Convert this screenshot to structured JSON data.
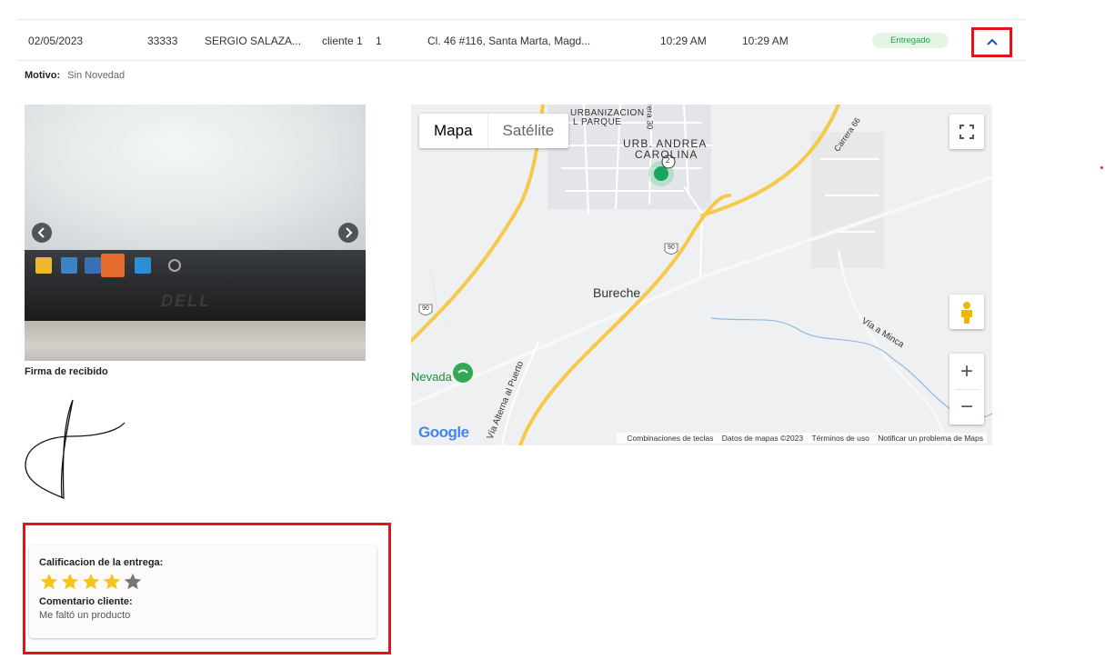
{
  "row": {
    "date": "02/05/2023",
    "code": "33333",
    "name": "SERGIO SALAZA...",
    "client": "cliente 1",
    "quantity": "1",
    "address": "Cl. 46 #116, Santa Marta, Magd...",
    "time_1": "10:29 AM",
    "time_2": "10:29 AM",
    "status": "Entregado",
    "status_color": "#2e9a48"
  },
  "motivo": {
    "label": "Motivo:",
    "value": "Sin Novedad"
  },
  "signature": {
    "label": "Firma de recibido"
  },
  "photo_text": {
    "logo": "DELL"
  },
  "map": {
    "view_map": "Mapa",
    "view_satellite": "Satélite",
    "labels": {
      "urbanizacion": "URBANIZACION",
      "el_parque": "L PARQUE",
      "andrea": "URB. ANDREA",
      "carolina": "CAROLINA",
      "bureche": "Bureche",
      "nevada": "Nevada",
      "via_minca": "Vía a Minca",
      "carrera66": "Carrera 66",
      "carrera30": "rera 30",
      "alterna": "Vía Alterna al Puerto",
      "road90a": "90",
      "road90b": "90",
      "marker_num": "2"
    },
    "google": "Google",
    "footer": {
      "shortcuts": "Combinaciones de teclas",
      "data": "Datos de mapas ©2023",
      "terms": "Términos de uso",
      "report": "Notificar un problema de Maps"
    },
    "zoom_in": "+",
    "zoom_out": "−"
  },
  "rating": {
    "title": "Calificacion de la entrega:",
    "value": 4,
    "max": 5,
    "comment_label": "Comentario cliente:",
    "comment": "Me faltó un producto",
    "star_color": "#f5c518",
    "star_empty_color": "#777777"
  },
  "colors": {
    "highlight": "#e2141b",
    "road": "#f6c94a"
  }
}
